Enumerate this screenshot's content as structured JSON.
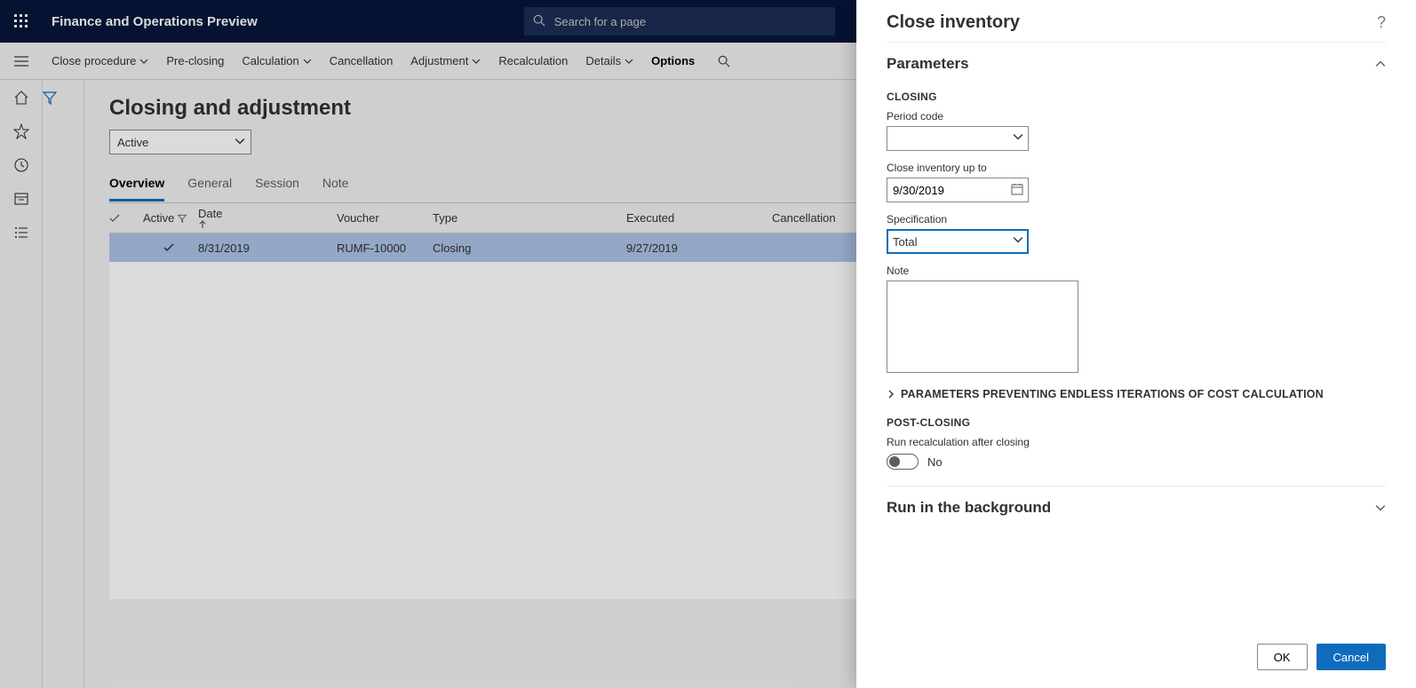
{
  "header": {
    "app_title": "Finance and Operations Preview",
    "search_placeholder": "Search for a page"
  },
  "actions": {
    "close_procedure": "Close procedure",
    "pre_closing": "Pre-closing",
    "calculation": "Calculation",
    "cancellation": "Cancellation",
    "adjustment": "Adjustment",
    "recalculation": "Recalculation",
    "details": "Details",
    "options": "Options"
  },
  "page": {
    "title": "Closing and adjustment",
    "view_filter": "Active",
    "tabs": {
      "overview": "Overview",
      "general": "General",
      "session": "Session",
      "note": "Note"
    },
    "columns": {
      "active": "Active",
      "date": "Date",
      "voucher": "Voucher",
      "type": "Type",
      "executed": "Executed",
      "cancellation": "Cancellation"
    },
    "row": {
      "date": "8/31/2019",
      "voucher": "RUMF-10000",
      "type": "Closing",
      "executed": "9/27/2019"
    }
  },
  "panel": {
    "title": "Close inventory",
    "parameters_label": "Parameters",
    "closing_label": "CLOSING",
    "period_code_label": "Period code",
    "close_up_to_label": "Close inventory up to",
    "close_up_to_value": "9/30/2019",
    "specification_label": "Specification",
    "specification_value": "Total",
    "note_label": "Note",
    "endless_label": "PARAMETERS PREVENTING ENDLESS ITERATIONS OF COST CALCULATION",
    "post_closing_label": "POST-CLOSING",
    "run_recalc_label": "Run recalculation after closing",
    "run_recalc_value": "No",
    "run_bg_label": "Run in the background",
    "ok": "OK",
    "cancel": "Cancel"
  }
}
